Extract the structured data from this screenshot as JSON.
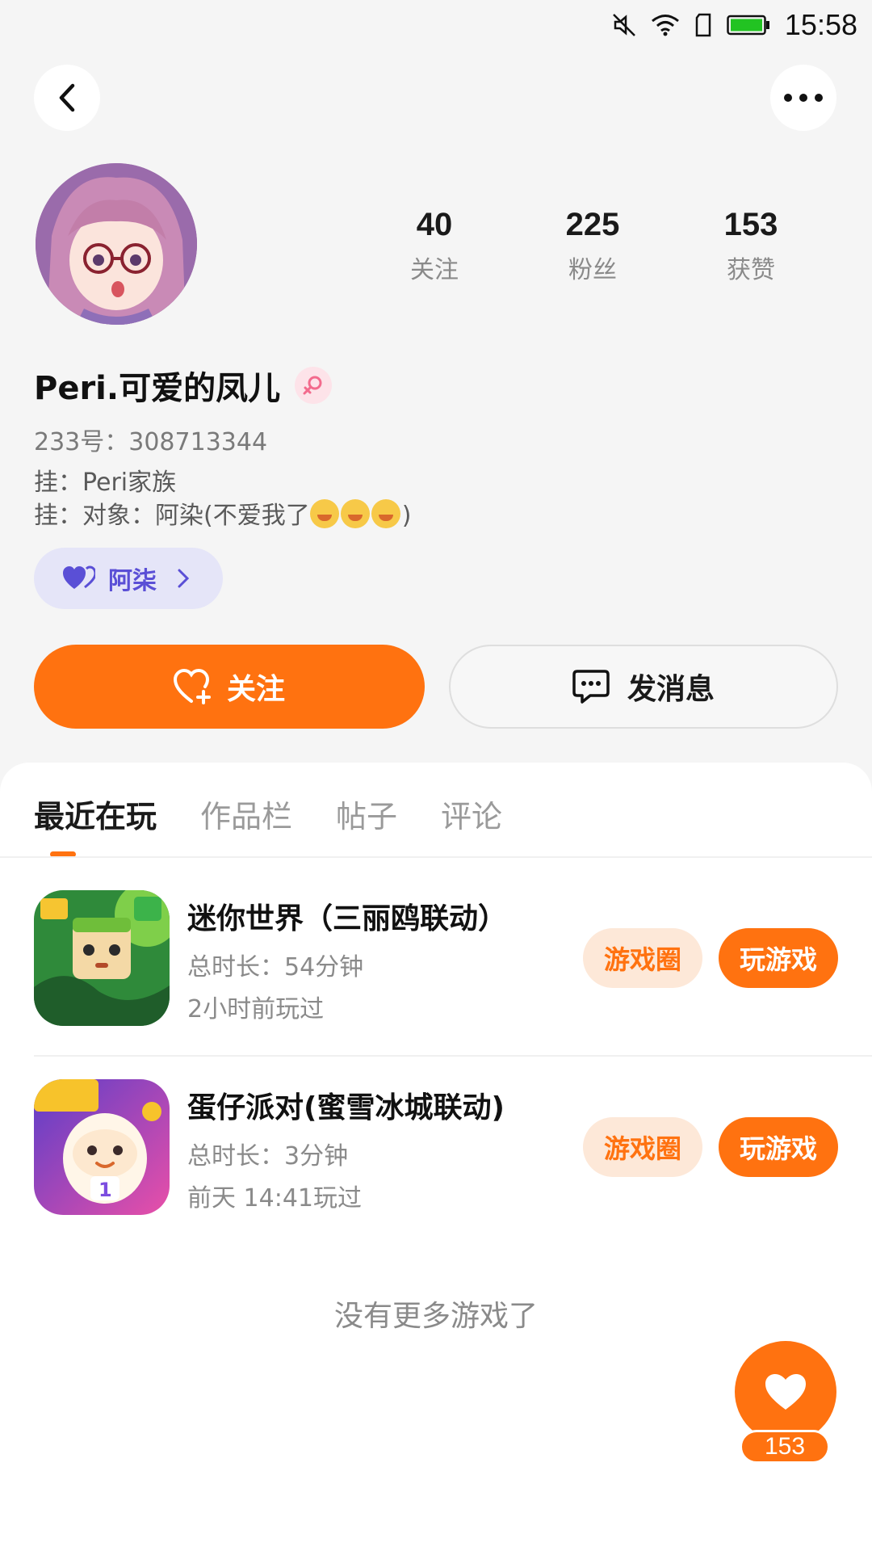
{
  "status_bar": {
    "time": "15:58",
    "icons": [
      "mute-icon",
      "wifi-icon",
      "sim-icon",
      "battery-icon"
    ],
    "battery_color": "#22c322"
  },
  "header": {
    "back_icon": "back-arrow-icon",
    "more_icon": "more-dots-icon"
  },
  "profile": {
    "nickname": "Peri.可爱的凤儿",
    "gender_icon": "female-icon",
    "uid": "233号：308713344",
    "bio_line1": "挂：Peri家族",
    "bio_line2": "挂：对象：阿染(不爱我了",
    "bio_line2_end": ")",
    "stats": [
      {
        "value": "40",
        "label": "关注"
      },
      {
        "value": "225",
        "label": "粉丝"
      },
      {
        "value": "153",
        "label": "获赞"
      }
    ],
    "cp_name": "阿柒"
  },
  "actions": {
    "follow_label": "关注",
    "message_label": "发消息"
  },
  "tabs": [
    {
      "label": "最近在玩",
      "active": true
    },
    {
      "label": "作品栏",
      "active": false
    },
    {
      "label": "帖子",
      "active": false
    },
    {
      "label": "评论",
      "active": false
    }
  ],
  "games": [
    {
      "name": "迷你世界（三丽鸥联动）",
      "duration": "总时长：54分钟",
      "last_played": "2小时前玩过",
      "circle_label": "游戏圈",
      "play_label": "玩游戏"
    },
    {
      "name": "蛋仔派对(蜜雪冰城联动)",
      "duration": "总时长：3分钟",
      "last_played": "前天 14:41玩过",
      "circle_label": "游戏圈",
      "play_label": "玩游戏"
    }
  ],
  "no_more_text": "没有更多游戏了",
  "like_fab": {
    "icon": "heart-icon",
    "count": "153"
  },
  "colors": {
    "accent": "#ff7210",
    "cp_purple": "#5a4fd6",
    "page_bg": "#f5f5f5"
  }
}
